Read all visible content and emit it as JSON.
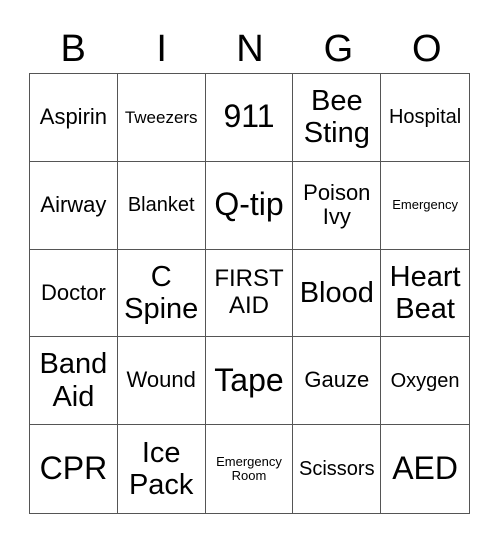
{
  "header": [
    "B",
    "I",
    "N",
    "G",
    "O"
  ],
  "cells": [
    "Aspirin",
    "Tweezers",
    "911",
    "Bee Sting",
    "Hospital",
    "Airway",
    "Blanket",
    "Q-tip",
    "Poison Ivy",
    "Emergency",
    "Doctor",
    "C Spine",
    "FIRST AID",
    "Blood",
    "Heart Beat",
    "Band Aid",
    "Wound",
    "Tape",
    "Gauze",
    "Oxygen",
    "CPR",
    "Ice Pack",
    "Emergency Room",
    "Scissors",
    "AED"
  ]
}
